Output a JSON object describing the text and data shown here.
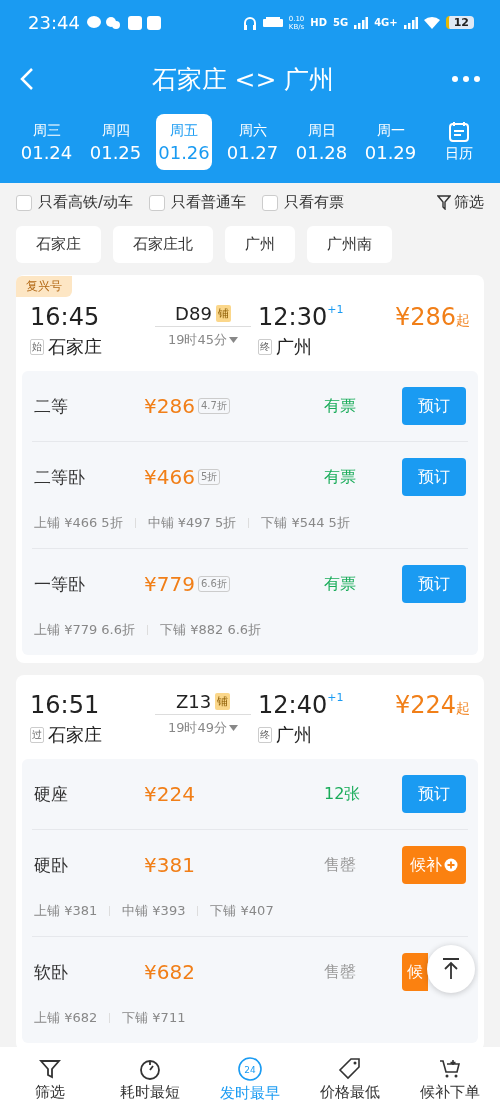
{
  "status_bar": {
    "time": "23:44",
    "net_speed": "0.10",
    "net_unit": "KB/s",
    "hd": "HD",
    "net_5g": "5G",
    "net_4g": "4G+",
    "battery": "12"
  },
  "header": {
    "title": "石家庄 <> 广州"
  },
  "dates": [
    {
      "weekday": "周三",
      "date": "01.24",
      "selected": false
    },
    {
      "weekday": "周四",
      "date": "01.25",
      "selected": false
    },
    {
      "weekday": "周五",
      "date": "01.26",
      "selected": true
    },
    {
      "weekday": "周六",
      "date": "01.27",
      "selected": false
    },
    {
      "weekday": "周日",
      "date": "01.28",
      "selected": false
    },
    {
      "weekday": "周一",
      "date": "01.29",
      "selected": false
    }
  ],
  "calendar": {
    "label": "日历"
  },
  "filters": [
    {
      "label": "只看高铁/动车",
      "checked": false
    },
    {
      "label": "只看普通车",
      "checked": false
    },
    {
      "label": "只看有票",
      "checked": false
    }
  ],
  "filter_button": {
    "label": "筛选"
  },
  "stations": [
    "石家庄",
    "石家庄北",
    "广州",
    "广州南"
  ],
  "trains": [
    {
      "badge": "复兴号",
      "dep_time": "16:45",
      "number": "D89",
      "tag": "铺",
      "arr_time": "12:30",
      "day_offset": "+1",
      "price": "¥286",
      "price_suffix": "起",
      "dep_mark": "始",
      "dep_station": "石家庄",
      "duration": "19时45分",
      "arr_mark": "终",
      "arr_station": "广州",
      "seats": [
        {
          "name": "二等",
          "price": "¥286",
          "discount": "4.7折",
          "availability": "有票",
          "available": true,
          "button": {
            "kind": "book",
            "label": "预订"
          }
        },
        {
          "name": "二等卧",
          "price": "¥466",
          "discount": "5折",
          "availability": "有票",
          "available": true,
          "button": {
            "kind": "book",
            "label": "预订"
          },
          "berths": [
            "上铺 ¥466 5折",
            "中铺 ¥497 5折",
            "下铺 ¥544 5折"
          ]
        },
        {
          "name": "一等卧",
          "price": "¥779",
          "discount": "6.6折",
          "availability": "有票",
          "available": true,
          "button": {
            "kind": "book",
            "label": "预订"
          },
          "berths": [
            "上铺 ¥779 6.6折",
            "下铺 ¥882 6.6折"
          ]
        }
      ]
    },
    {
      "dep_time": "16:51",
      "number": "Z13",
      "tag": "铺",
      "arr_time": "12:40",
      "day_offset": "+1",
      "price": "¥224",
      "price_suffix": "起",
      "dep_mark": "过",
      "dep_station": "石家庄",
      "duration": "19时49分",
      "arr_mark": "终",
      "arr_station": "广州",
      "seats": [
        {
          "name": "硬座",
          "price": "¥224",
          "availability": "12张",
          "available": true,
          "button": {
            "kind": "book",
            "label": "预订"
          }
        },
        {
          "name": "硬卧",
          "price": "¥381",
          "availability": "售罄",
          "available": false,
          "button": {
            "kind": "waitlist",
            "label": "候补",
            "plus_icon": true
          },
          "berths": [
            "上铺 ¥381",
            "中铺 ¥393",
            "下铺 ¥407"
          ]
        },
        {
          "name": "软卧",
          "price": "¥682",
          "availability": "售罄",
          "available": false,
          "button": {
            "kind": "waitlist",
            "label": "候",
            "clipped": true
          },
          "berths": [
            "上铺 ¥682",
            "下铺 ¥711"
          ]
        }
      ]
    }
  ],
  "bottom_nav": [
    {
      "kind": "filter",
      "label": "筛选",
      "selected": false
    },
    {
      "kind": "timer",
      "label": "耗时最短",
      "selected": false
    },
    {
      "kind": "clock24",
      "icon_text": "24",
      "label": "发时最早",
      "selected": true
    },
    {
      "kind": "tag",
      "label": "价格最低",
      "selected": false
    },
    {
      "kind": "cart",
      "label": "候补下单",
      "selected": false
    }
  ]
}
